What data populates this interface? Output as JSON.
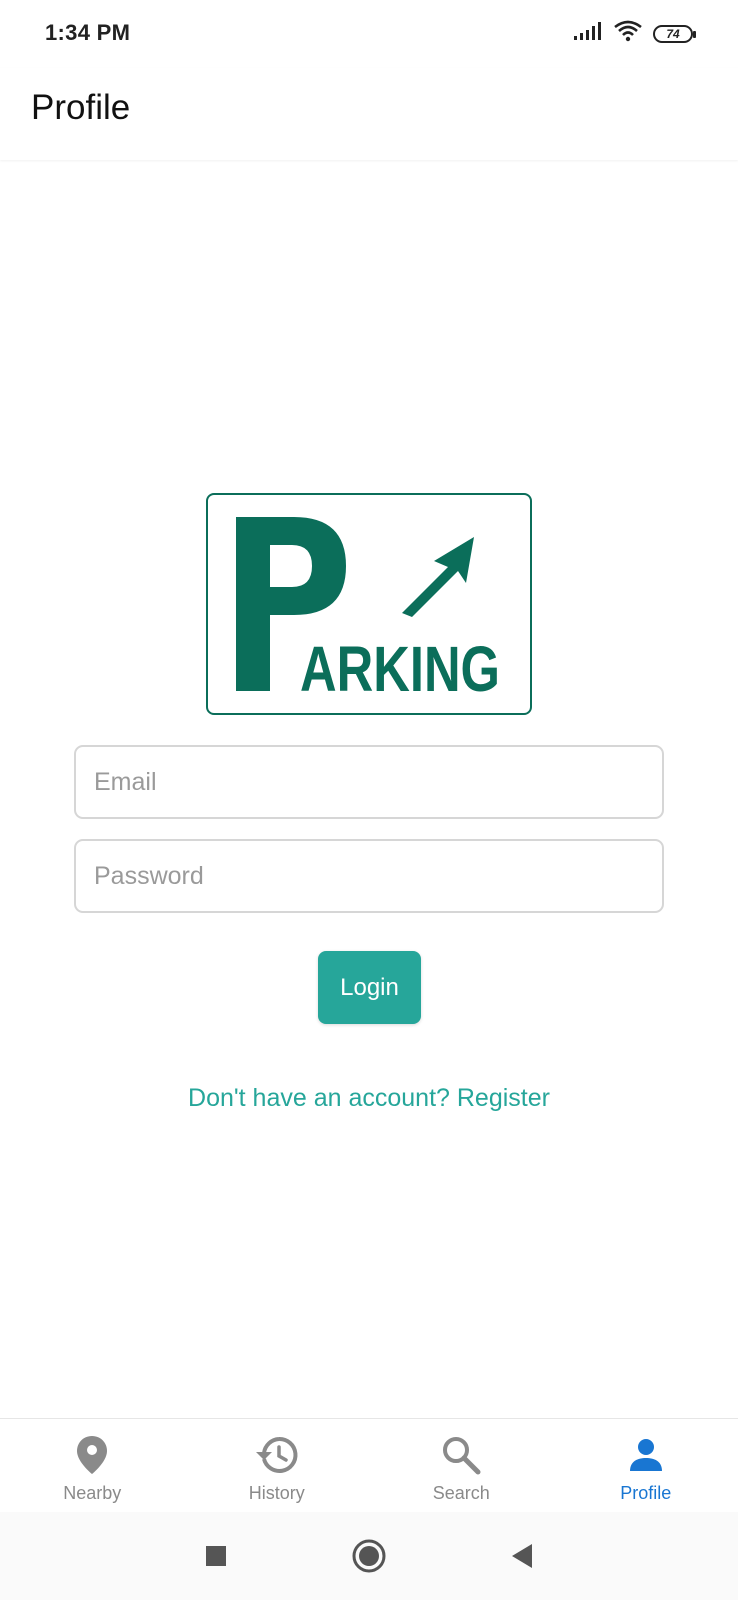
{
  "status_bar": {
    "time": "1:34 PM",
    "battery": "74",
    "icons": [
      "signal-icon",
      "wifi-icon",
      "battery-icon"
    ]
  },
  "header": {
    "title": "Profile"
  },
  "logo": {
    "text": "PARKING",
    "color": "#0b6e5a"
  },
  "form": {
    "email_placeholder": "Email",
    "password_placeholder": "Password",
    "login_label": "Login",
    "register_text": "Don't have an account? Register"
  },
  "bottom_nav": {
    "items": [
      {
        "label": "Nearby",
        "icon": "location-pin-icon",
        "active": false
      },
      {
        "label": "History",
        "icon": "history-icon",
        "active": false
      },
      {
        "label": "Search",
        "icon": "search-icon",
        "active": false
      },
      {
        "label": "Profile",
        "icon": "person-icon",
        "active": true
      }
    ]
  },
  "colors": {
    "accent": "#26a69a",
    "active_nav": "#1976d2",
    "inactive_nav": "#8a8a8a",
    "logo_green": "#0b6e5a"
  },
  "system_nav": {
    "icons": [
      "recents-icon",
      "home-icon",
      "back-icon"
    ]
  }
}
